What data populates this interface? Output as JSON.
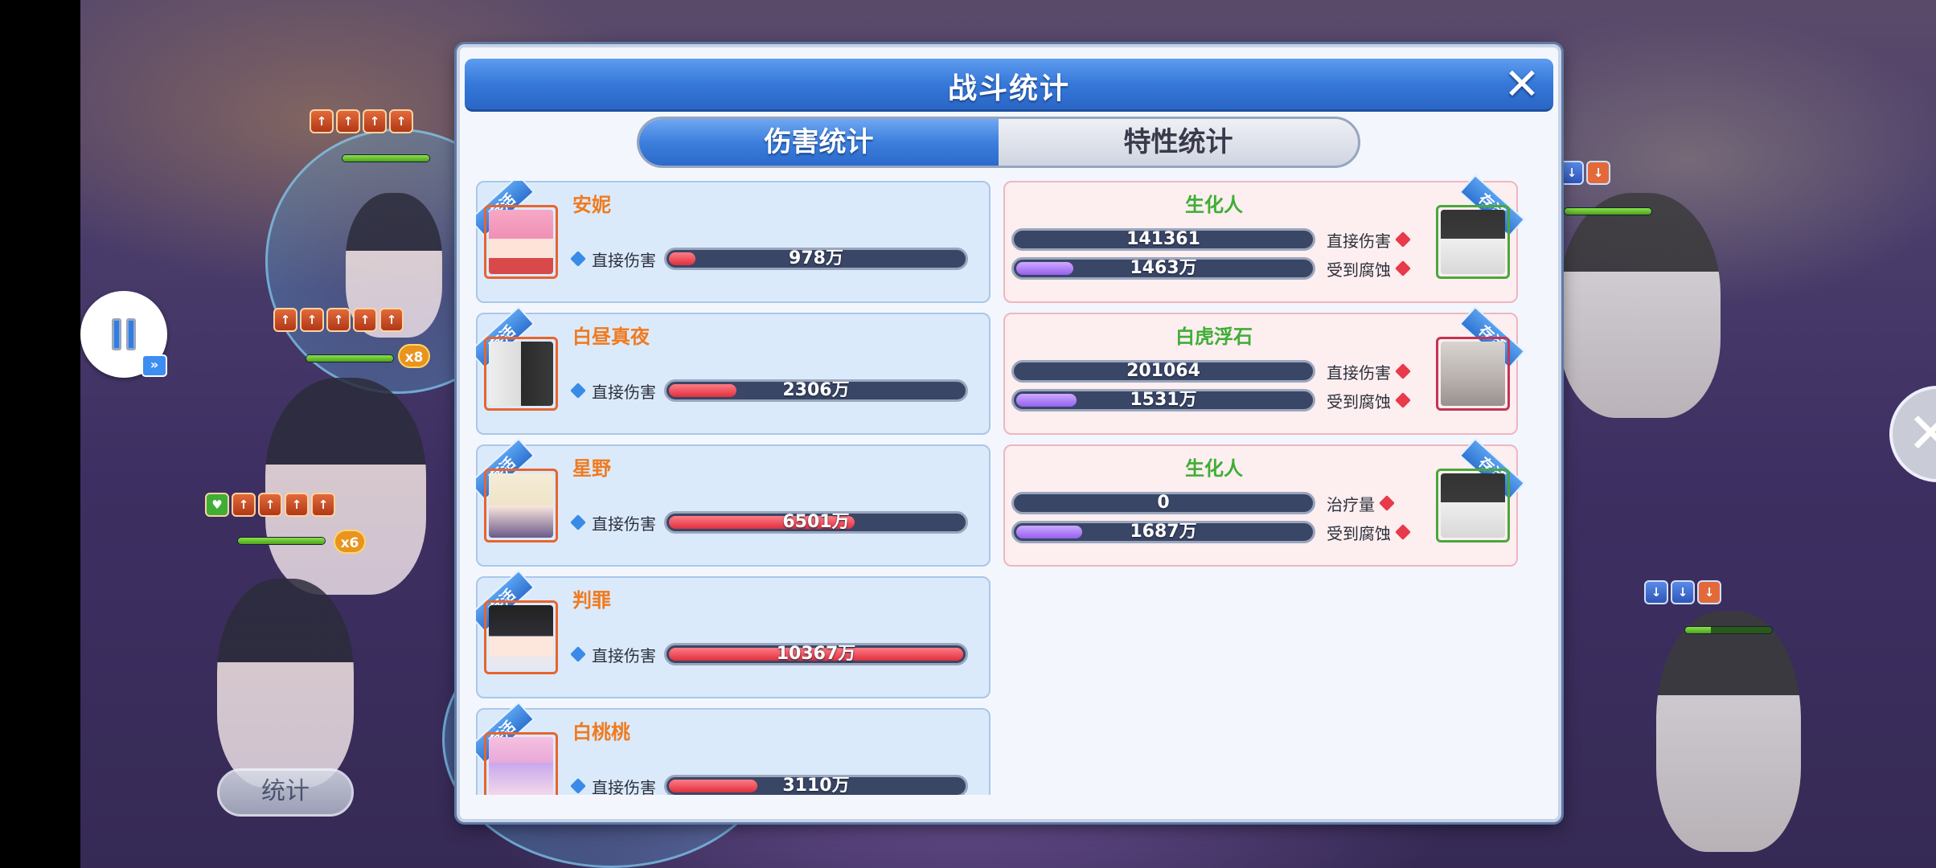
{
  "modal": {
    "title": "战斗统计",
    "tabs": [
      {
        "label": "伤害统计",
        "active": true
      },
      {
        "label": "特性统计",
        "active": false
      }
    ]
  },
  "status_ribbon": "存活",
  "allies": [
    {
      "name": "安妮",
      "stat_label": "直接伤害",
      "value": "978万",
      "fill_fraction": 0.09
    },
    {
      "name": "白昼真夜",
      "stat_label": "直接伤害",
      "value": "2306万",
      "fill_fraction": 0.23
    },
    {
      "name": "星野",
      "stat_label": "直接伤害",
      "value": "6501万",
      "fill_fraction": 0.63
    },
    {
      "name": "判罪",
      "stat_label": "直接伤害",
      "value": "10367万",
      "fill_fraction": 1.0
    },
    {
      "name": "白桃桃",
      "stat_label": "直接伤害",
      "value": "3110万",
      "fill_fraction": 0.3
    }
  ],
  "enemies": [
    {
      "name": "生化人",
      "avatar_border": "green",
      "stats": [
        {
          "label": "直接伤害",
          "value": "141361",
          "color": "red",
          "fill_fraction": 0.0
        },
        {
          "label": "受到腐蚀",
          "value": "1463万",
          "color": "purple",
          "fill_fraction": 0.14
        }
      ]
    },
    {
      "name": "白虎浮石",
      "avatar_border": "crimson",
      "stats": [
        {
          "label": "直接伤害",
          "value": "201064",
          "color": "red",
          "fill_fraction": 0.0
        },
        {
          "label": "受到腐蚀",
          "value": "1531万",
          "color": "purple",
          "fill_fraction": 0.15
        }
      ]
    },
    {
      "name": "生化人",
      "avatar_border": "green",
      "stats": [
        {
          "label": "治疗量",
          "value": "0",
          "color": "red",
          "fill_fraction": 0.0
        },
        {
          "label": "受到腐蚀",
          "value": "1687万",
          "color": "purple",
          "fill_fraction": 0.17
        }
      ]
    }
  ],
  "hud": {
    "stat_button": "统计",
    "buff_counts": [
      "x8",
      "x8",
      "x6"
    ]
  },
  "colors": {
    "ally_name": "#f07a1e",
    "enemy_name": "#3fae35",
    "header_blue": "#3678d8",
    "damage_red": "#e0303e",
    "corrosion_purple": "#9660ee"
  }
}
